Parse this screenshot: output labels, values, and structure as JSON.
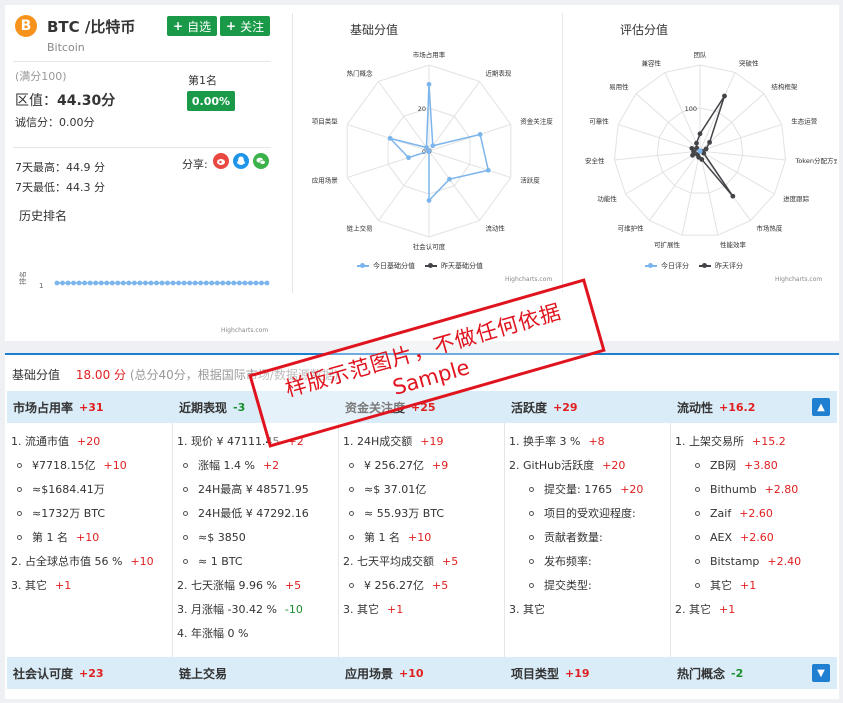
{
  "coin": {
    "logo": "B",
    "name": "BTC /比特币",
    "en_name": "Bitcoin",
    "watch_label": "自选",
    "follow_label": "关注"
  },
  "score": {
    "full": "(满分100)",
    "label": "区值：",
    "value": "44.30分",
    "credit": "诚信分：0.00分",
    "rank": "第1名",
    "change": "0.00%"
  },
  "stats": {
    "high7": "7天最高：44.9 分",
    "low7": "7天最低：44.3 分",
    "share_label": "分享:",
    "history_title": "历史排名",
    "rank_axis": "排名",
    "rank_tick": "1",
    "credits": "Highcharts.com",
    "rank_series": [
      1,
      1,
      1,
      1,
      1,
      1,
      1,
      1,
      1,
      1,
      1,
      1,
      1,
      1,
      1,
      1,
      1,
      1,
      1,
      1,
      1,
      1,
      1,
      1,
      1,
      1,
      1,
      1,
      1,
      1,
      1,
      1,
      1,
      1,
      1,
      1,
      1,
      1,
      1
    ]
  },
  "colors": {
    "green": "#1a9a48",
    "red": "#e02020",
    "blue": "#1f7fd0",
    "today": "#7cb5ec",
    "yesterday": "#434348",
    "header_bg": "#d9ecf7"
  },
  "icons": {
    "weibo": "weibo-icon",
    "qq": "qq-icon",
    "wechat": "wechat-icon"
  },
  "chart_data": [
    {
      "type": "radar",
      "title": "基础分值",
      "categories": [
        "市场占用率",
        "近期表现",
        "资金关注度",
        "活跃度",
        "流动性",
        "社会认可度",
        "链上交易",
        "应用场景",
        "项目类型",
        "热门概念"
      ],
      "tick_labels": [
        "0",
        "20"
      ],
      "rmax": 40,
      "series": [
        {
          "name": "今日基础分值",
          "color": "#7cb5ec",
          "values": [
            31,
            3,
            25,
            29,
            16.2,
            23,
            0,
            10,
            19,
            2
          ]
        },
        {
          "name": "昨天基础分值",
          "color": "#434348",
          "values": [
            0,
            0,
            0,
            0,
            0,
            0,
            0,
            0,
            0,
            0
          ]
        }
      ],
      "legend": "bottom",
      "credits": "Highcharts.com"
    },
    {
      "type": "radar",
      "title": "评估分值",
      "categories": [
        "团队",
        "突破性",
        "结构框架",
        "生态运营",
        "Token分配方式",
        "进度跟踪",
        "市场热度",
        "性能效率",
        "可扩展性",
        "可维护性",
        "功能性",
        "安全性",
        "可靠性",
        "易用性",
        "兼容性"
      ],
      "tick_labels": [
        "0",
        "100"
      ],
      "rmax": 200,
      "series": [
        {
          "name": "今日评分",
          "color": "#7cb5ec",
          "values": [
            0,
            0,
            0,
            0,
            0,
            0,
            0,
            0,
            0,
            0,
            0,
            0,
            0,
            0,
            0
          ]
        },
        {
          "name": "昨天评分",
          "color": "#434348",
          "values": [
            40,
            140,
            30,
            15,
            5,
            10,
            130,
            20,
            15,
            10,
            20,
            15,
            20,
            10,
            20
          ]
        }
      ],
      "legend": "bottom",
      "credits": "Highcharts.com"
    }
  ],
  "radar1": {
    "title": "基础分值",
    "legend_today": "今日基础分值",
    "legend_yesterday": "昨天基础分值",
    "tick0": "0",
    "tick20": "20",
    "credits": "Highcharts.com"
  },
  "radar2": {
    "title": "评估分值",
    "legend_today": "今日评分",
    "legend_yesterday": "昨天评分",
    "tick0": "0",
    "tick100": "100",
    "credits": "Highcharts.com"
  },
  "stamp": {
    "line1": "样版示范图片，不做任何依据",
    "line2": "Sample"
  },
  "basic": {
    "title": "基础分值",
    "score": "18.00 分",
    "note": "(总分40分，根据国际市场/数据源数据)",
    "columns": [
      {
        "head": "市场占用率",
        "val": "+31",
        "rows": [
          {
            "lvl": 1,
            "text": "1. 流通市值",
            "val": "+20"
          },
          {
            "lvl": 2,
            "text": "¥7718.15亿",
            "val": "+10"
          },
          {
            "lvl": 2,
            "text": "≈$1684.41万",
            "val": ""
          },
          {
            "lvl": 2,
            "text": "≈1732万 BTC",
            "val": ""
          },
          {
            "lvl": 2,
            "text": "第 1 名",
            "val": "+10"
          },
          {
            "lvl": 1,
            "text": "2. 占全球总市值 56 %",
            "val": "+10"
          },
          {
            "lvl": 1,
            "text": "3. 其它",
            "val": "+1"
          }
        ]
      },
      {
        "head": "近期表现",
        "val": "-3",
        "rows": [
          {
            "lvl": 1,
            "text": "1. 现价 ¥ 47111.45",
            "val": "+2"
          },
          {
            "lvl": 2,
            "text": "涨幅 1.4 %",
            "val": "+2"
          },
          {
            "lvl": 2,
            "text": "24H最高 ¥ 48571.95",
            "val": ""
          },
          {
            "lvl": 2,
            "text": "24H最低 ¥ 47292.16",
            "val": ""
          },
          {
            "lvl": 2,
            "text": "≈$ 3850",
            "val": ""
          },
          {
            "lvl": 2,
            "text": "≈ 1 BTC",
            "val": ""
          },
          {
            "lvl": 1,
            "text": "2. 七天涨幅 9.96 %",
            "val": "+5"
          },
          {
            "lvl": 1,
            "text": "3. 月涨幅 -30.42 %",
            "val": "-10"
          },
          {
            "lvl": 1,
            "text": "4. 年涨幅 0 %",
            "val": ""
          }
        ]
      },
      {
        "head": "资金关注度",
        "val": "+25",
        "rows": [
          {
            "lvl": 1,
            "text": "1. 24H成交额",
            "val": "+19"
          },
          {
            "lvl": 2,
            "text": "¥ 256.27亿",
            "val": "+9"
          },
          {
            "lvl": 2,
            "text": "≈$ 37.01亿",
            "val": ""
          },
          {
            "lvl": 2,
            "text": "≈ 55.93万 BTC",
            "val": ""
          },
          {
            "lvl": 2,
            "text": "第 1 名",
            "val": "+10"
          },
          {
            "lvl": 1,
            "text": "2. 七天平均成交额",
            "val": "+5"
          },
          {
            "lvl": 2,
            "text": "¥ 256.27亿",
            "val": "+5"
          },
          {
            "lvl": 1,
            "text": "3. 其它",
            "val": "+1"
          }
        ]
      },
      {
        "head": "活跃度",
        "val": "+29",
        "rows": [
          {
            "lvl": 1,
            "text": "1. 换手率 3 %",
            "val": "+8"
          },
          {
            "lvl": 1,
            "text": "2. GitHub活跃度",
            "val": "+20"
          },
          {
            "lvl": 3,
            "text": "提交量: 1765",
            "val": "+20"
          },
          {
            "lvl": 3,
            "text": "项目的受欢迎程度:",
            "val": ""
          },
          {
            "lvl": 3,
            "text": "贡献者数量:",
            "val": ""
          },
          {
            "lvl": 3,
            "text": "发布频率:",
            "val": ""
          },
          {
            "lvl": 3,
            "text": "提交类型:",
            "val": ""
          },
          {
            "lvl": 1,
            "text": "3. 其它",
            "val": ""
          }
        ]
      },
      {
        "head": "流动性",
        "val": "+16.2",
        "rows": [
          {
            "lvl": 1,
            "text": "1. 上架交易所",
            "val": "+15.2"
          },
          {
            "lvl": 3,
            "text": "ZB网",
            "val": "+3.80"
          },
          {
            "lvl": 3,
            "text": "Bithumb",
            "val": "+2.80"
          },
          {
            "lvl": 3,
            "text": "Zaif",
            "val": "+2.60"
          },
          {
            "lvl": 3,
            "text": "AEX",
            "val": "+2.60"
          },
          {
            "lvl": 3,
            "text": "Bitstamp",
            "val": "+2.40"
          },
          {
            "lvl": 3,
            "text": "其它",
            "val": "+1"
          },
          {
            "lvl": 1,
            "text": "2. 其它",
            "val": "+1"
          }
        ]
      }
    ],
    "footer": [
      {
        "head": "社会认可度",
        "val": "+23",
        "color": "red"
      },
      {
        "head": "链上交易",
        "val": "",
        "color": "red"
      },
      {
        "head": "应用场景",
        "val": "+10",
        "color": "red"
      },
      {
        "head": "项目类型",
        "val": "+19",
        "color": "red"
      },
      {
        "head": "热门概念",
        "val": "-2",
        "color": "green"
      }
    ]
  }
}
